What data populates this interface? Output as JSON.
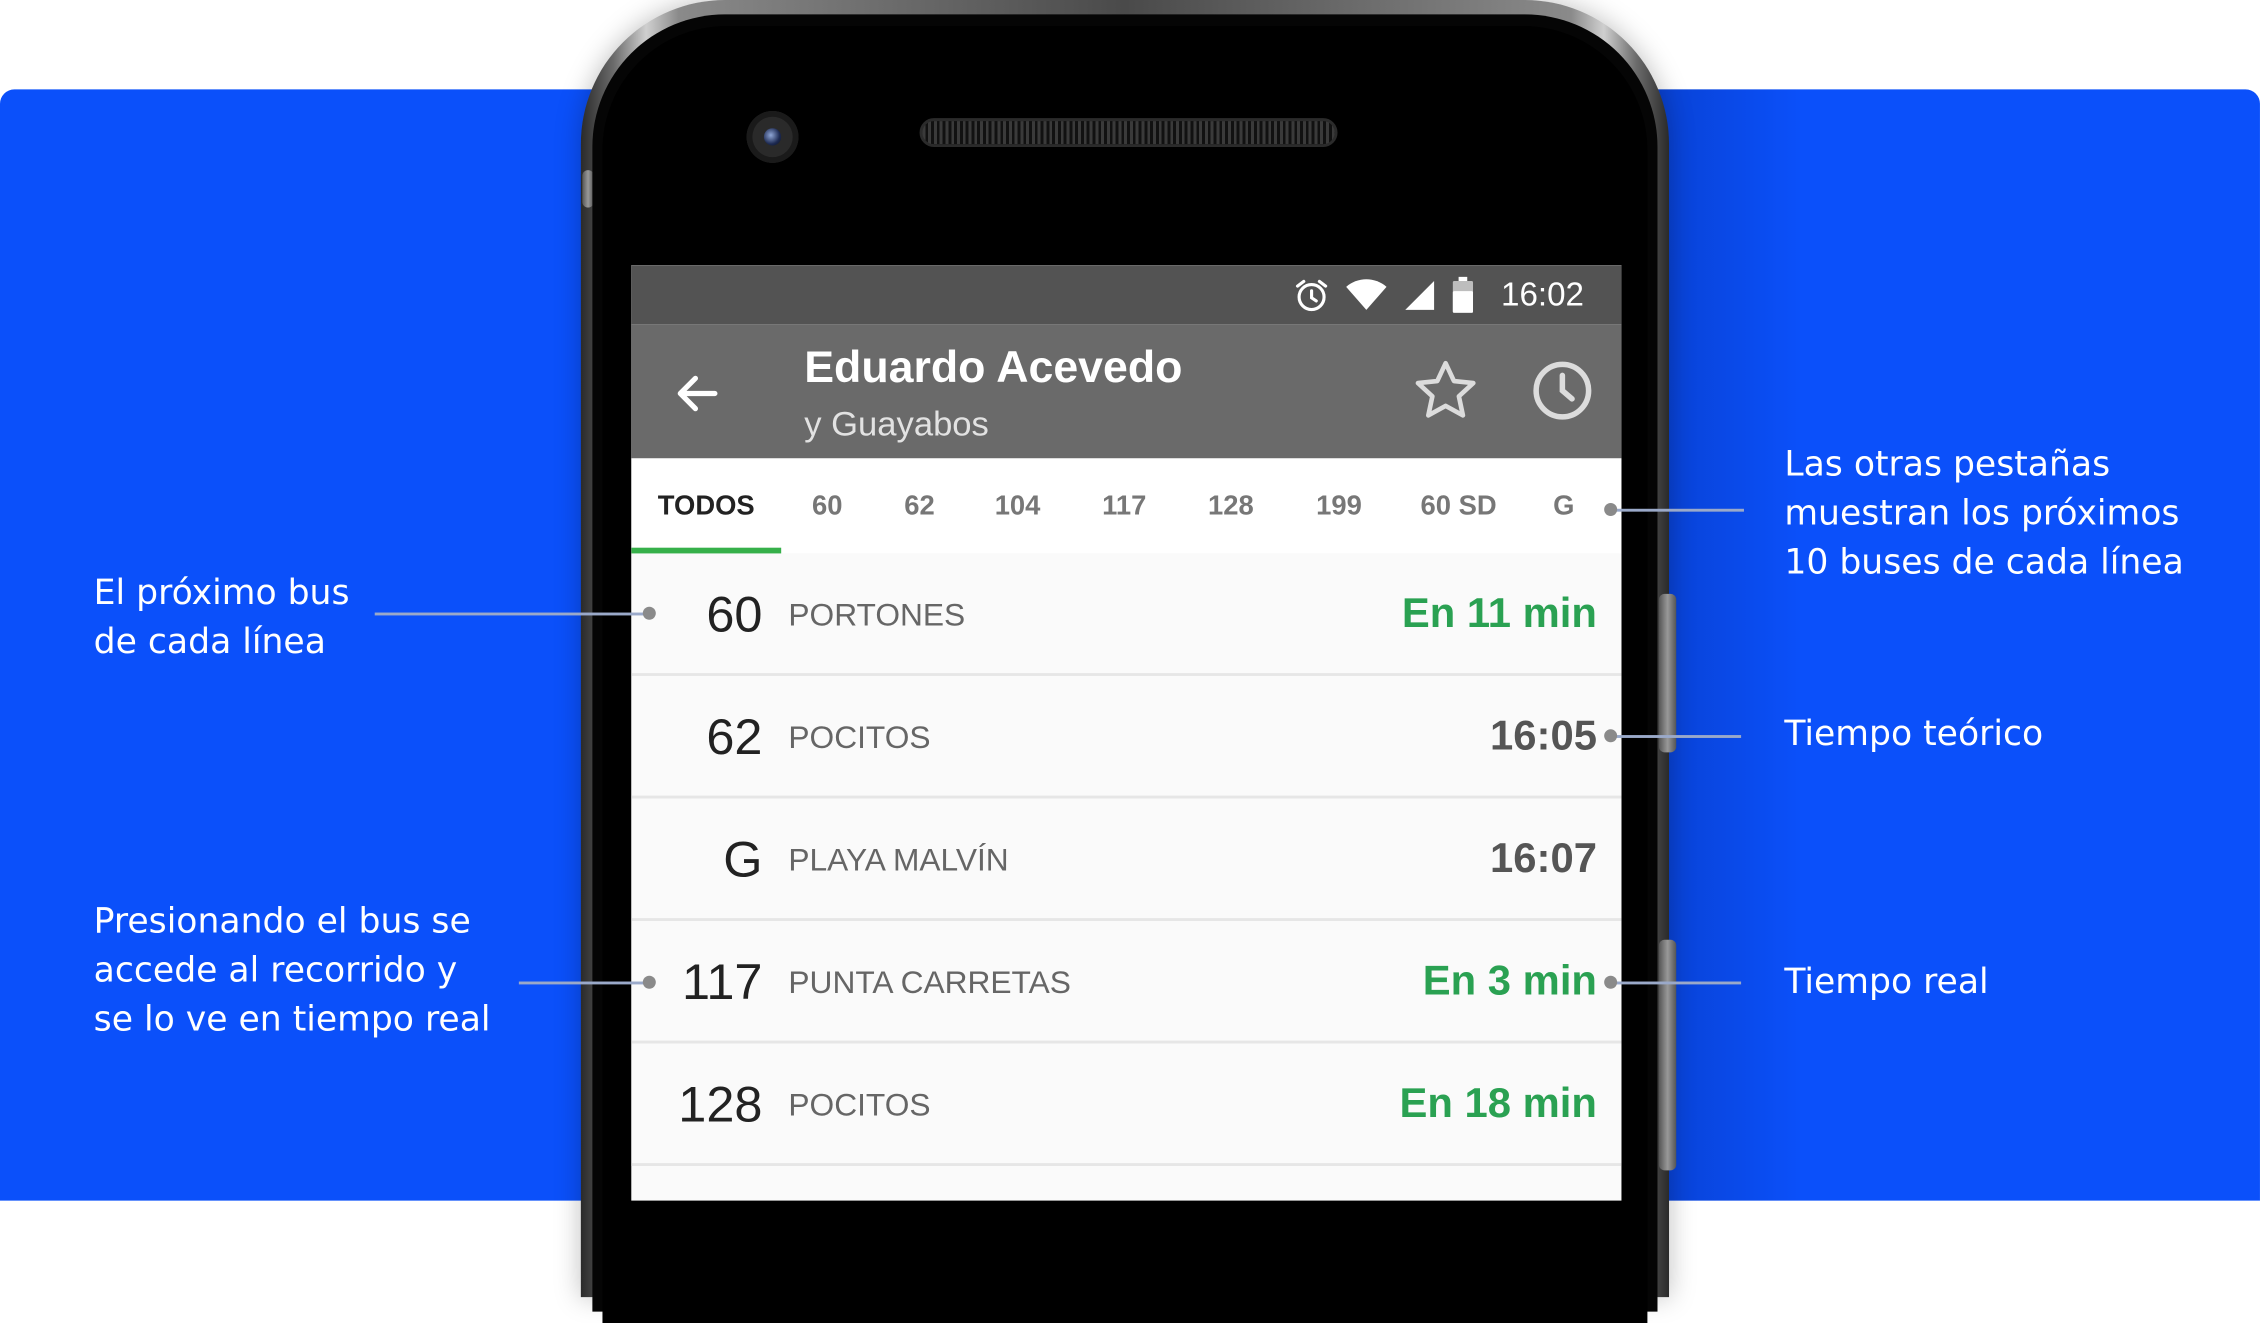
{
  "status_bar": {
    "time": "16:02",
    "icons": [
      "alarm-icon",
      "wifi-icon",
      "cell-signal-icon",
      "battery-icon"
    ]
  },
  "app_bar": {
    "title": "Eduardo Acevedo",
    "subtitle": "y Guayabos",
    "icons": [
      "back-arrow-icon",
      "star-icon",
      "clock-icon"
    ]
  },
  "tabs": {
    "items": [
      "TODOS",
      "60",
      "62",
      "104",
      "117",
      "128",
      "199",
      "60 SD",
      "G"
    ],
    "active": "TODOS"
  },
  "arrivals": [
    {
      "line": "60",
      "destination": "PORTONES",
      "time": "En 11 min",
      "realtime": true
    },
    {
      "line": "62",
      "destination": "POCITOS",
      "time": "16:05",
      "realtime": false
    },
    {
      "line": "G",
      "destination": "PLAYA MALVÍN",
      "time": "16:07",
      "realtime": false
    },
    {
      "line": "117",
      "destination": "PUNTA CARRETAS",
      "time": "En 3 min",
      "realtime": true
    },
    {
      "line": "128",
      "destination": "POCITOS",
      "time": "En 18 min",
      "realtime": true
    }
  ],
  "annotations": {
    "next_bus": [
      "El próximo bus",
      "de cada línea"
    ],
    "press_bus": [
      "Presionando el bus se",
      "accede al recorrido y",
      "se lo ve en tiempo real"
    ],
    "other_tabs": [
      "Las otras pestañas",
      "muestran los próximos",
      "10 buses de cada línea"
    ],
    "scheduled_time": [
      "Tiempo teórico"
    ],
    "real_time": [
      "Tiempo real"
    ]
  },
  "colors": {
    "background_blue": "#0b50fa",
    "realtime_green": "#2aa152",
    "appbar_gray": "#6a6a6a",
    "statusbar_gray": "#535353",
    "tab_indicator": "#36b04a"
  }
}
